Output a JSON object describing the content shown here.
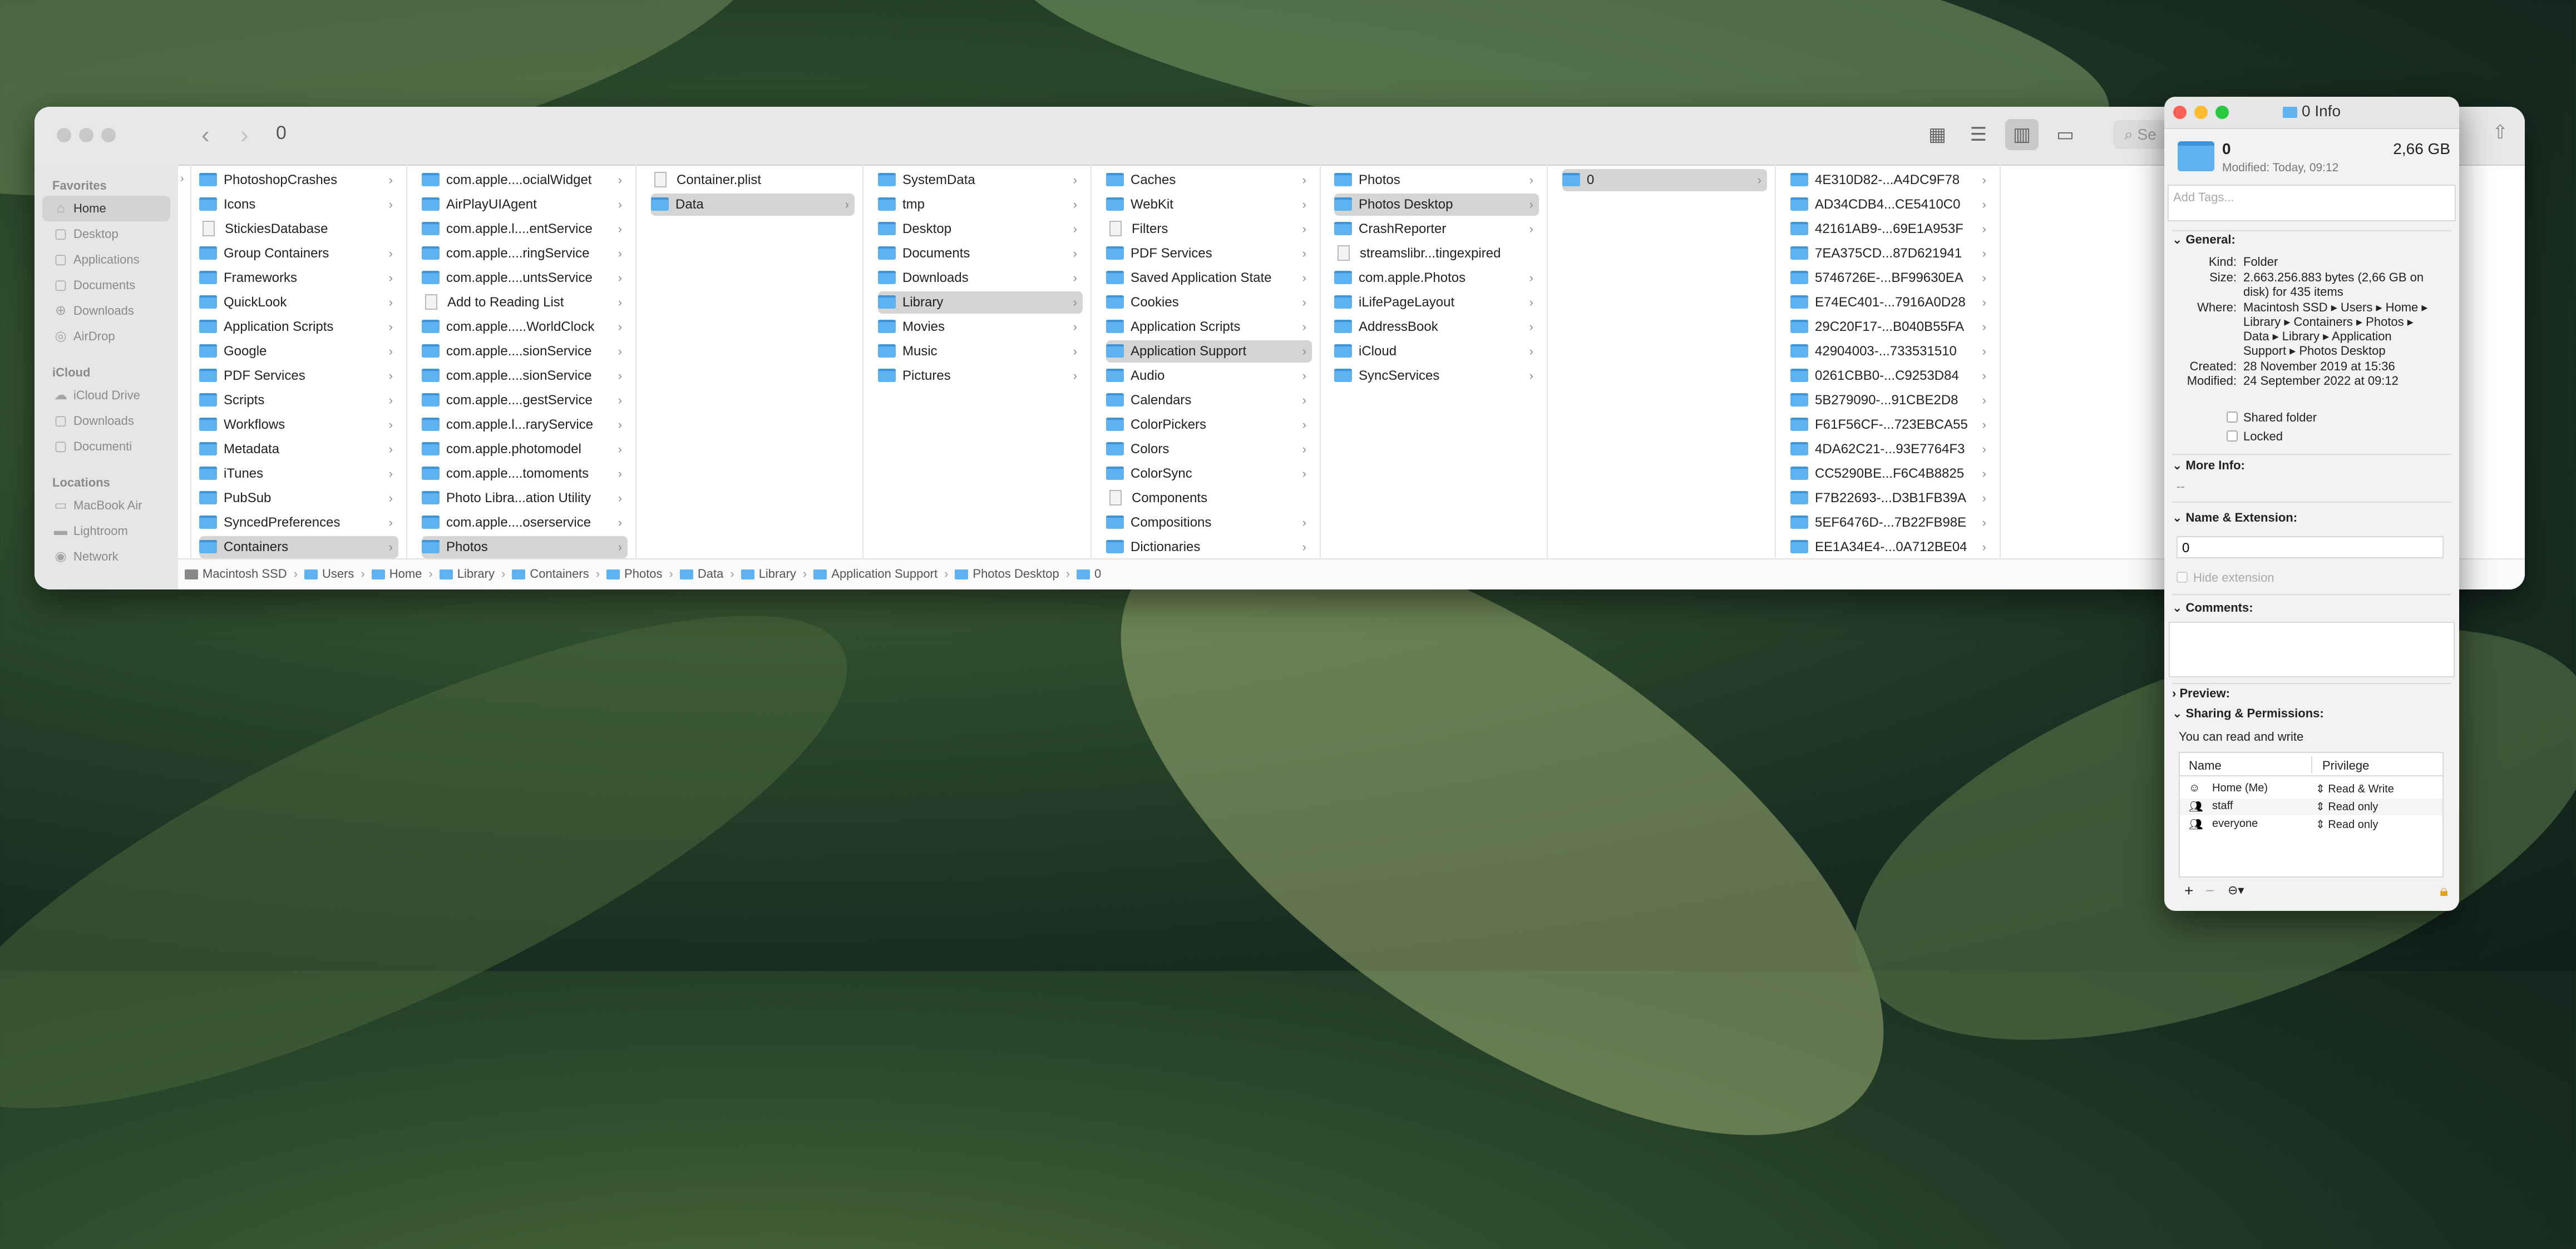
{
  "finder": {
    "title": "0",
    "sidebar": {
      "favorites_header": "Favorites",
      "favorites": [
        {
          "label": "Home",
          "icon": "home-icon",
          "selected": true
        },
        {
          "label": "Desktop",
          "icon": "desktop-icon"
        },
        {
          "label": "Applications",
          "icon": "applications-icon"
        },
        {
          "label": "Documents",
          "icon": "document-icon"
        },
        {
          "label": "Downloads",
          "icon": "download-icon"
        },
        {
          "label": "AirDrop",
          "icon": "airdrop-icon"
        }
      ],
      "icloud_header": "iCloud",
      "icloud": [
        {
          "label": "iCloud Drive",
          "icon": "cloud-icon"
        },
        {
          "label": "Downloads",
          "icon": "folder-icon"
        },
        {
          "label": "Documenti",
          "icon": "folder-icon"
        }
      ],
      "locations_header": "Locations",
      "locations": [
        {
          "label": "MacBook Air",
          "icon": "laptop-icon"
        },
        {
          "label": "Lightroom",
          "icon": "drive-icon"
        },
        {
          "label": "Network",
          "icon": "network-icon"
        }
      ]
    },
    "columns": [
      {
        "items": [
          {
            "label": "PhotoshopCrashes",
            "type": "folder",
            "chev": true
          },
          {
            "label": "Icons",
            "type": "folder",
            "chev": true
          },
          {
            "label": "StickiesDatabase",
            "type": "doc",
            "chev": false
          },
          {
            "label": "Group Containers",
            "type": "folder",
            "chev": true
          },
          {
            "label": "Frameworks",
            "type": "folder",
            "chev": true
          },
          {
            "label": "QuickLook",
            "type": "folder",
            "chev": true
          },
          {
            "label": "Application Scripts",
            "type": "folder",
            "chev": true
          },
          {
            "label": "Google",
            "type": "folder",
            "chev": true
          },
          {
            "label": "PDF Services",
            "type": "folder",
            "chev": true
          },
          {
            "label": "Scripts",
            "type": "folder",
            "chev": true
          },
          {
            "label": "Workflows",
            "type": "folder",
            "chev": true
          },
          {
            "label": "Metadata",
            "type": "folder",
            "chev": true
          },
          {
            "label": "iTunes",
            "type": "folder",
            "chev": true
          },
          {
            "label": "PubSub",
            "type": "folder",
            "chev": true
          },
          {
            "label": "SyncedPreferences",
            "type": "folder",
            "chev": true
          },
          {
            "label": "Containers",
            "type": "folder",
            "chev": true,
            "selected": true
          }
        ]
      },
      {
        "items": [
          {
            "label": "com.apple....ocialWidget",
            "type": "folder",
            "chev": true
          },
          {
            "label": "AirPlayUIAgent",
            "type": "folder",
            "chev": true
          },
          {
            "label": "com.apple.l....entService",
            "type": "folder",
            "chev": true
          },
          {
            "label": "com.apple....ringService",
            "type": "folder",
            "chev": true
          },
          {
            "label": "com.apple....untsService",
            "type": "folder",
            "chev": true
          },
          {
            "label": "Add to Reading List",
            "type": "doc",
            "chev": true
          },
          {
            "label": "com.apple.....WorldClock",
            "type": "folder",
            "chev": true
          },
          {
            "label": "com.apple....sionService",
            "type": "folder",
            "chev": true
          },
          {
            "label": "com.apple....sionService",
            "type": "folder",
            "chev": true
          },
          {
            "label": "com.apple....gestService",
            "type": "folder",
            "chev": true
          },
          {
            "label": "com.apple.l...raryService",
            "type": "folder",
            "chev": true
          },
          {
            "label": "com.apple.photomodel",
            "type": "folder",
            "chev": true
          },
          {
            "label": "com.apple....tomoments",
            "type": "folder",
            "chev": true
          },
          {
            "label": "Photo Libra...ation Utility",
            "type": "folder",
            "chev": true
          },
          {
            "label": "com.apple....oserservice",
            "type": "folder",
            "chev": true
          },
          {
            "label": "Photos",
            "type": "folder",
            "chev": true,
            "selected": true
          }
        ]
      },
      {
        "items": [
          {
            "label": "Container.plist",
            "type": "doc",
            "chev": false
          },
          {
            "label": "Data",
            "type": "folder",
            "chev": true,
            "selected": true
          }
        ]
      },
      {
        "items": [
          {
            "label": "SystemData",
            "type": "folder",
            "chev": true
          },
          {
            "label": "tmp",
            "type": "folder",
            "chev": true
          },
          {
            "label": "Desktop",
            "type": "folder",
            "chev": true
          },
          {
            "label": "Documents",
            "type": "folder",
            "chev": true
          },
          {
            "label": "Downloads",
            "type": "folder",
            "chev": true
          },
          {
            "label": "Library",
            "type": "folder",
            "chev": true,
            "selected": true
          },
          {
            "label": "Movies",
            "type": "folder",
            "chev": true
          },
          {
            "label": "Music",
            "type": "folder",
            "chev": true
          },
          {
            "label": "Pictures",
            "type": "folder",
            "chev": true
          }
        ]
      },
      {
        "items": [
          {
            "label": "Caches",
            "type": "folder",
            "chev": true
          },
          {
            "label": "WebKit",
            "type": "folder",
            "chev": true
          },
          {
            "label": "Filters",
            "type": "doc",
            "chev": true
          },
          {
            "label": "PDF Services",
            "type": "folder",
            "chev": true
          },
          {
            "label": "Saved Application State",
            "type": "folder",
            "chev": true
          },
          {
            "label": "Cookies",
            "type": "folder",
            "chev": true
          },
          {
            "label": "Application Scripts",
            "type": "folder",
            "chev": true
          },
          {
            "label": "Application Support",
            "type": "folder",
            "chev": true,
            "selected": true
          },
          {
            "label": "Audio",
            "type": "folder",
            "chev": true
          },
          {
            "label": "Calendars",
            "type": "folder",
            "chev": true
          },
          {
            "label": "ColorPickers",
            "type": "folder",
            "chev": true
          },
          {
            "label": "Colors",
            "type": "folder",
            "chev": true
          },
          {
            "label": "ColorSync",
            "type": "folder",
            "chev": true
          },
          {
            "label": "Components",
            "type": "doc",
            "chev": false
          },
          {
            "label": "Compositions",
            "type": "folder",
            "chev": true
          },
          {
            "label": "Dictionaries",
            "type": "folder",
            "chev": true
          }
        ]
      },
      {
        "items": [
          {
            "label": "Photos",
            "type": "folder",
            "chev": true
          },
          {
            "label": "Photos Desktop",
            "type": "folder",
            "chev": true,
            "selected": true
          },
          {
            "label": "CrashReporter",
            "type": "folder",
            "chev": true
          },
          {
            "label": "streamslibr...tingexpired",
            "type": "doc",
            "chev": false
          },
          {
            "label": "com.apple.Photos",
            "type": "folder",
            "chev": true
          },
          {
            "label": "iLifePageLayout",
            "type": "folder",
            "chev": true
          },
          {
            "label": "AddressBook",
            "type": "folder",
            "chev": true
          },
          {
            "label": "iCloud",
            "type": "folder",
            "chev": true
          },
          {
            "label": "SyncServices",
            "type": "folder",
            "chev": true
          }
        ]
      },
      {
        "items": [
          {
            "label": "0",
            "type": "folder",
            "chev": true,
            "selected": true
          }
        ]
      },
      {
        "items": [
          {
            "label": "4E310D82-...A4DC9F78",
            "type": "folder",
            "chev": true
          },
          {
            "label": "AD34CDB4...CE5410C0",
            "type": "folder",
            "chev": true
          },
          {
            "label": "42161AB9-...69E1A953F",
            "type": "folder",
            "chev": true
          },
          {
            "label": "7EA375CD...87D621941",
            "type": "folder",
            "chev": true
          },
          {
            "label": "5746726E-...BF99630EA",
            "type": "folder",
            "chev": true
          },
          {
            "label": "E74EC401-...7916A0D28",
            "type": "folder",
            "chev": true
          },
          {
            "label": "29C20F17-...B040B55FA",
            "type": "folder",
            "chev": true
          },
          {
            "label": "42904003-...733531510",
            "type": "folder",
            "chev": true
          },
          {
            "label": "0261CBB0-...C9253D84",
            "type": "folder",
            "chev": true
          },
          {
            "label": "5B279090-...91CBE2D8",
            "type": "folder",
            "chev": true
          },
          {
            "label": "F61F56CF-...723EBCA55",
            "type": "folder",
            "chev": true
          },
          {
            "label": "4DA62C21-...93E7764F3",
            "type": "folder",
            "chev": true
          },
          {
            "label": "CC5290BE...F6C4B8825",
            "type": "folder",
            "chev": true
          },
          {
            "label": "F7B22693-...D3B1FB39A",
            "type": "folder",
            "chev": true
          },
          {
            "label": "5EF6476D-...7B22FB98E",
            "type": "folder",
            "chev": true
          },
          {
            "label": "EE1A34E4-...0A712BE04",
            "type": "folder",
            "chev": true
          }
        ]
      }
    ],
    "pathbar": [
      "Macintosh SSD",
      "Users",
      "Home",
      "Library",
      "Containers",
      "Photos",
      "Data",
      "Library",
      "Application Support",
      "Photos Desktop",
      "0"
    ],
    "search_placeholder": "Se"
  },
  "info": {
    "title": "0 Info",
    "name": "0",
    "size_short": "2,66 GB",
    "modified_short": "Modified: Today, 09:12",
    "tags_placeholder": "Add Tags...",
    "general_header": "General:",
    "kind_label": "Kind:",
    "kind": "Folder",
    "size_label": "Size:",
    "size_line1": "2.663.256.883 bytes (2,66 GB on",
    "size_line2": "disk) for 435 items",
    "where_label": "Where:",
    "where_line1": "Macintosh SSD ▸ Users ▸ Home ▸",
    "where_line2": "Library ▸ Containers ▸ Photos ▸",
    "where_line3": "Data ▸ Library ▸ Application",
    "where_line4": "Support ▸ Photos Desktop",
    "created_label": "Created:",
    "created": "28 November 2019 at 15:36",
    "modified_label": "Modified:",
    "modified": "24 September 2022 at 09:12",
    "shared_folder": "Shared folder",
    "locked": "Locked",
    "more_info_header": "More Info:",
    "more_info_value": "--",
    "name_ext_header": "Name & Extension:",
    "name_field": "0",
    "hide_extension": "Hide extension",
    "comments_header": "Comments:",
    "preview_header": "Preview:",
    "sharing_header": "Sharing & Permissions:",
    "sharing_note": "You can read and write",
    "perm_col_name": "Name",
    "perm_col_priv": "Privilege",
    "permissions": [
      {
        "name": "Home (Me)",
        "privilege": "Read & Write",
        "icon": "user-icon"
      },
      {
        "name": "staff",
        "privilege": "Read only",
        "icon": "group-icon"
      },
      {
        "name": "everyone",
        "privilege": "Read only",
        "icon": "group-icon"
      }
    ],
    "add_symbol": "+",
    "remove_symbol": "−",
    "action_symbol": "⊖▾"
  }
}
